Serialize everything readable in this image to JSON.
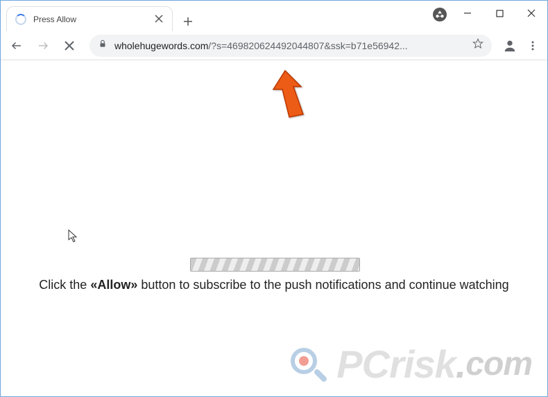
{
  "tab": {
    "title": "Press Allow"
  },
  "omnibox": {
    "host": "wholehugewords.com",
    "path": "/?s=469820624492044807&ssk=b71e56942..."
  },
  "page": {
    "message_prefix": "Click the ",
    "message_strong": "«Allow»",
    "message_suffix": " button to subscribe to the push notifications and continue watching"
  },
  "watermark": {
    "text1": "PC",
    "text2": "risk",
    "dot": ".",
    "com": "com"
  }
}
